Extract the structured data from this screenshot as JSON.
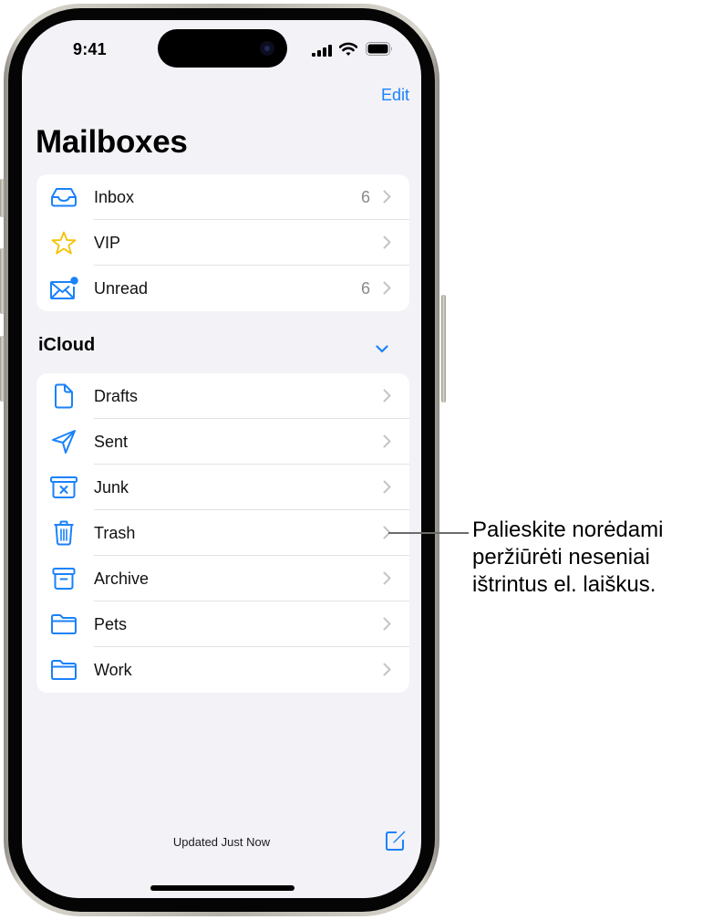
{
  "status_bar": {
    "time": "9:41"
  },
  "nav": {
    "edit_label": "Edit",
    "title": "Mailboxes"
  },
  "colors": {
    "accent": "#1a82fb",
    "vip": "#f6c000",
    "background": "#f2f2f7"
  },
  "main_mailboxes": [
    {
      "label": "Inbox",
      "count": "6",
      "icon": "tray-icon"
    },
    {
      "label": "VIP",
      "count": "",
      "icon": "star-icon"
    },
    {
      "label": "Unread",
      "count": "6",
      "icon": "unread-envelope-icon"
    }
  ],
  "icloud": {
    "section_title": "iCloud",
    "expanded": true,
    "mailboxes": [
      {
        "label": "Drafts",
        "icon": "document-icon"
      },
      {
        "label": "Sent",
        "icon": "paperplane-icon"
      },
      {
        "label": "Junk",
        "icon": "junk-bin-icon"
      },
      {
        "label": "Trash",
        "icon": "trash-icon"
      },
      {
        "label": "Archive",
        "icon": "archive-box-icon"
      },
      {
        "label": "Pets",
        "icon": "folder-icon"
      },
      {
        "label": "Work",
        "icon": "folder-icon"
      }
    ]
  },
  "footer": {
    "status": "Updated Just Now",
    "compose_icon": "compose-icon"
  },
  "callout": {
    "lines": [
      "Palieskite norėdami",
      "peržiūrėti neseniai",
      "ištrintus el. laiškus."
    ]
  }
}
